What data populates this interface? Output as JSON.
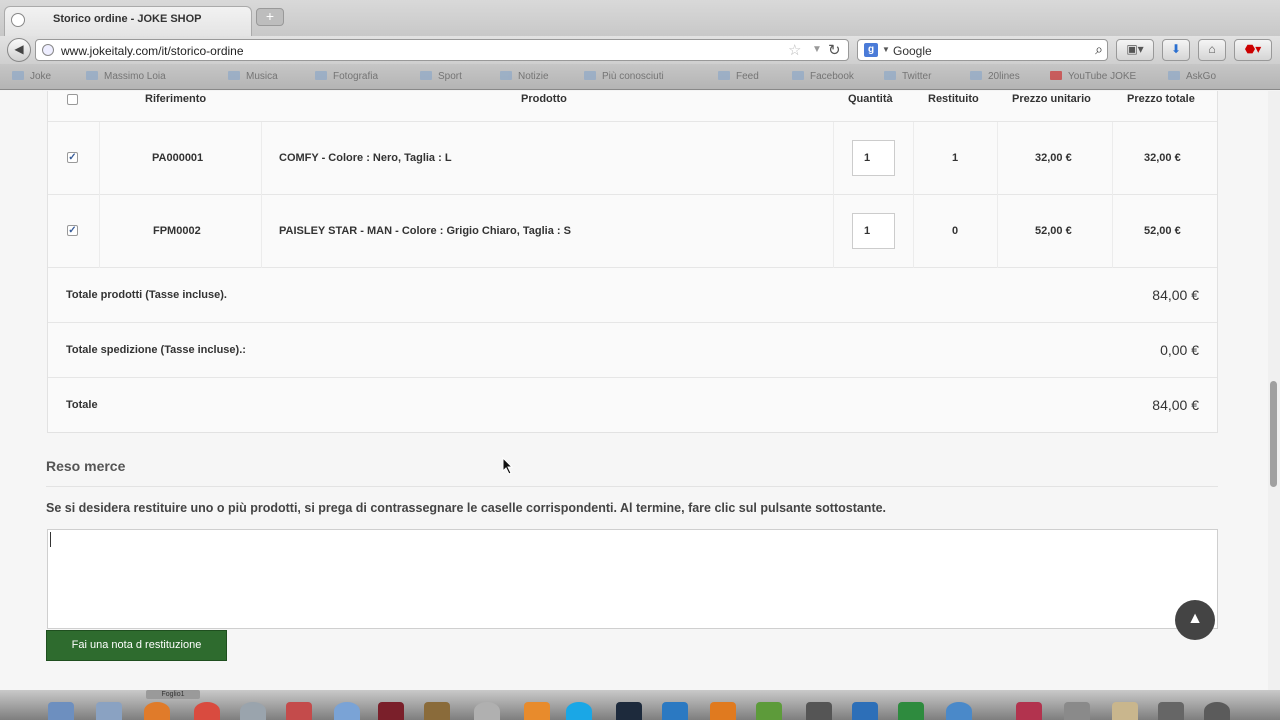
{
  "browser": {
    "tab_title": "Storico ordine - JOKE SHOP",
    "newtab_label": "+",
    "url": "www.jokeitaly.com/it/storico-ordine",
    "search_placeholder": "Google",
    "bookmarks": [
      "Joke",
      "Massimo Loia",
      "Musica",
      "Fotografia",
      "Sport",
      "Notizie",
      "Più conosciuti",
      "Feed",
      "Facebook",
      "Twitter",
      "20lines",
      "YouTube JOKE",
      "AskGo"
    ]
  },
  "order": {
    "headers": {
      "reference": "Riferimento",
      "product": "Prodotto",
      "quantity": "Quantità",
      "returned": "Restituito",
      "unit_price": "Prezzo unitario",
      "total_price": "Prezzo totale"
    },
    "rows": [
      {
        "reference": "PA000001",
        "product": "COMFY - Colore : Nero, Taglia : L",
        "quantity": "1",
        "returned": "1",
        "unit_price": "32,00 €",
        "total_price": "32,00 €",
        "checked_mark": "✓"
      },
      {
        "reference": "FPM0002",
        "product": "PAISLEY STAR - MAN - Colore : Grigio Chiaro, Taglia : S",
        "quantity": "1",
        "returned": "0",
        "unit_price": "52,00 €",
        "total_price": "52,00 €",
        "checked_mark": "✓"
      }
    ],
    "totals": [
      {
        "label": "Totale prodotti (Tasse incluse).",
        "value": "84,00 €"
      },
      {
        "label": "Totale spedizione (Tasse incluse).:",
        "value": "0,00 €"
      },
      {
        "label": "Totale",
        "value": "84,00 €"
      }
    ]
  },
  "returns": {
    "title": "Reso merce",
    "instruction": "Se si desidera restituire uno o più prodotti, si prega di contrassegnare le caselle corrispondenti. Al termine, fare clic sul pulsante sottostante.",
    "note_value": "",
    "submit_label": "Fai una nota d restituzione"
  },
  "dock": {
    "tab_label": "Foglio1"
  },
  "colors": {
    "submit_bg": "#2e6b2e",
    "to_top_bg": "#444444"
  }
}
